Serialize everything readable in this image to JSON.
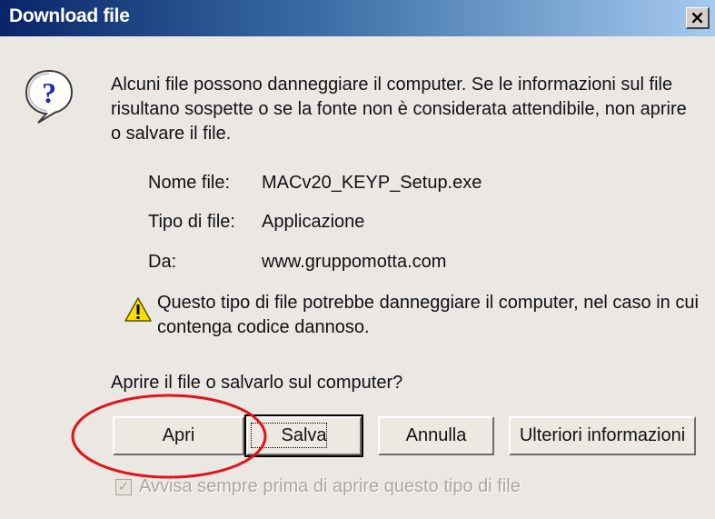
{
  "dialog": {
    "title": "Download file",
    "close_glyph": "×",
    "warning_message": "Alcuni file possono danneggiare il computer. Se le informazioni sul file risultano sospette o se la fonte non è considerata attendibile, non aprire o salvare il file.",
    "icon_question": "question-bubble-icon",
    "icon_warning": "warning-triangle-icon"
  },
  "file_info": {
    "name_label": "Nome file:",
    "name_value": "MACv20_KEYP_Setup.exe",
    "type_label": "Tipo di file:",
    "type_value": "Applicazione",
    "from_label": "Da:",
    "from_value": "www.gruppomotta.com"
  },
  "caution_message": "Questo tipo di file potrebbe danneggiare il computer, nel caso in cui contenga codice dannoso.",
  "question": "Aprire il file o salvarlo sul computer?",
  "buttons": {
    "open": "Apri",
    "save": "Salva",
    "cancel": "Annulla",
    "more_info": "Ulteriori informazioni"
  },
  "checkbox": {
    "label": "Avvisa sempre prima di aprire questo tipo di file",
    "checked": true,
    "enabled": false
  },
  "colors": {
    "title_gradient_start": "#0a246a",
    "title_gradient_end": "#a6caf0",
    "dialog_background": "#ebe8e4",
    "annotation_ellipse": "#e0141a"
  }
}
